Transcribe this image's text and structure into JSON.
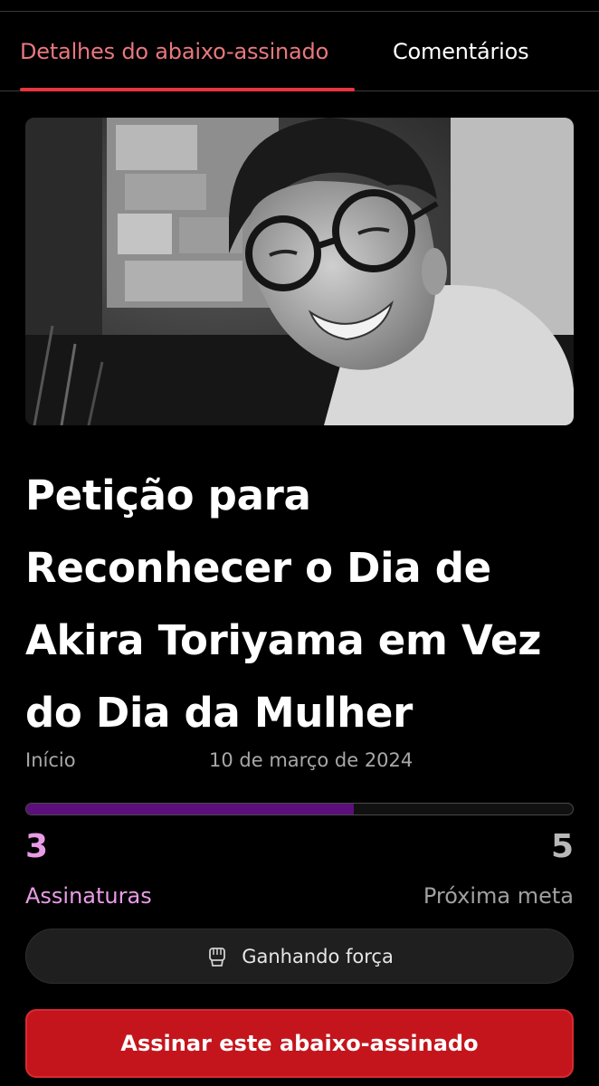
{
  "tabs": {
    "details": "Detalhes do abaixo-assinado",
    "comments": "Comentários"
  },
  "hero": {
    "alt": "Foto em preto e branco de um homem sorridente de óculos"
  },
  "petition": {
    "title": "Petição para Reconhecer o Dia de Akira Toriyama em Vez do Dia da Mulher",
    "start_label": "Início",
    "start_date": "10 de março de 2024"
  },
  "progress": {
    "signatures": "3",
    "signatures_label": "Assinaturas",
    "next_goal": "5",
    "next_goal_label": "Próxima meta",
    "fraction": 0.6
  },
  "momentum": {
    "label": "Ganhando força",
    "icon": "fist-icon"
  },
  "actions": {
    "sign_label": "Assinar este abaixo-assinado"
  },
  "colors": {
    "accent_tab": "#e8353f",
    "progress_fill": "#5b0f7a",
    "signatures": "#e99ce6",
    "sign_button": "#c4151c"
  }
}
